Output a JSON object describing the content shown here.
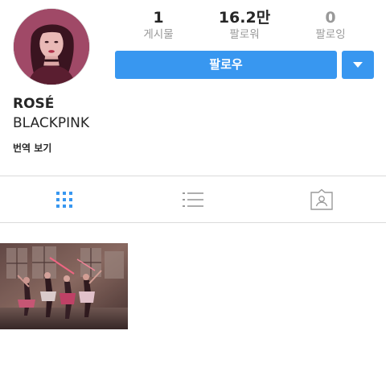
{
  "profile": {
    "name": "ROSÉ",
    "subtitle": "BLACKPINK",
    "translate_label": "번역 보기"
  },
  "stats": {
    "posts": {
      "count": "1",
      "label": "게시물"
    },
    "followers": {
      "count": "16.2만",
      "label": "팔로워"
    },
    "following": {
      "count": "0",
      "label": "팔로잉"
    }
  },
  "actions": {
    "follow_label": "팔로우",
    "dropdown_icon": "caret-down-icon"
  },
  "tabs": [
    {
      "icon": "grid-icon",
      "active": true
    },
    {
      "icon": "list-icon",
      "active": false
    },
    {
      "icon": "tagged-icon",
      "active": false
    }
  ],
  "colors": {
    "accent": "#3897f0",
    "text": "#262626",
    "muted": "#999999",
    "divider": "#dbdbdb"
  }
}
